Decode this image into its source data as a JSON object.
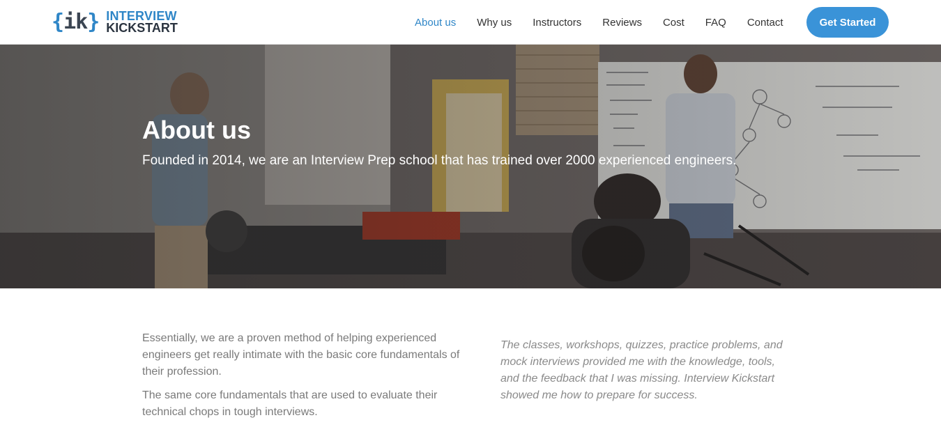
{
  "brand": {
    "logo_mark": "{ik}",
    "line1": "INTERVIEW",
    "line2": "KICKSTART",
    "accent_color": "#2f86c7"
  },
  "nav": {
    "items": [
      {
        "label": "About us",
        "active": true
      },
      {
        "label": "Why us"
      },
      {
        "label": "Instructors"
      },
      {
        "label": "Reviews"
      },
      {
        "label": "Cost"
      },
      {
        "label": "FAQ"
      },
      {
        "label": "Contact"
      }
    ],
    "cta_label": "Get Started",
    "cta_color": "#3a93d8"
  },
  "hero": {
    "title": "About us",
    "subtitle": "Founded in 2014, we are an Interview Prep school that has trained over 2000 experienced engineers.",
    "image": "classroom-photo"
  },
  "content": {
    "left_paragraphs": [
      "Essentially, we are a proven method of helping experienced engineers get really intimate with the basic core fundamentals of their profession.",
      "The same core fundamentals that are used to evaluate their technical chops in tough interviews."
    ],
    "quote": "The classes, workshops, quizzes, practice problems, and mock interviews provided me with the knowledge, tools, and the feedback that I was missing. Interview Kickstart showed me how to prepare for success."
  }
}
